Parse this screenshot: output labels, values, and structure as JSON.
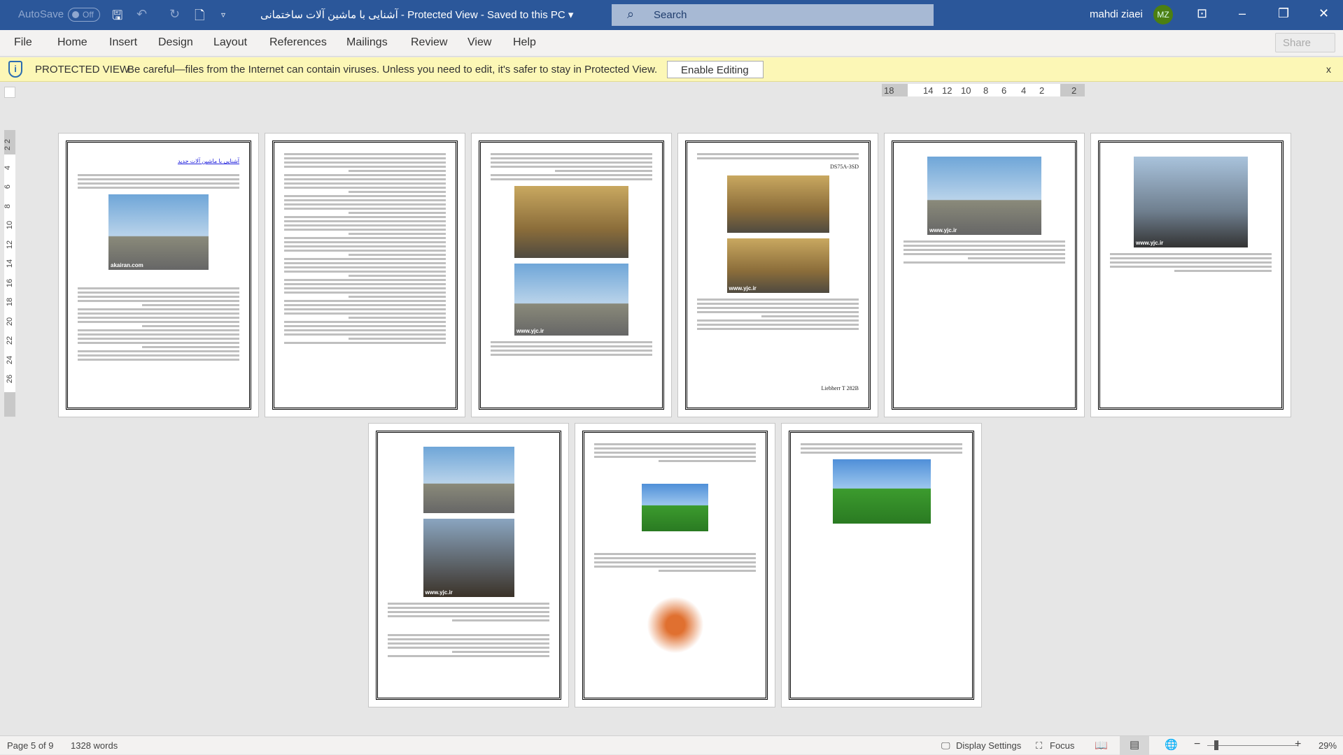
{
  "titlebar": {
    "autosave": "AutoSave",
    "autosave_state": "Off",
    "title": "آشنایی با ماشین آلات ساختمانی  -  Protected View  -  Saved to this PC  ▾",
    "search_placeholder": "Search",
    "user": "mahdi ziaei",
    "initials": "MZ",
    "avatar_color": "#4c7f12"
  },
  "menu": [
    "File",
    "Home",
    "Insert",
    "Design",
    "Layout",
    "References",
    "Mailings",
    "Review",
    "View",
    "Help"
  ],
  "share": "Share",
  "protected": {
    "label": "PROTECTED VIEW",
    "message": "Be careful—files from the Internet can contain viruses. Unless you need to edit, it's safer to stay in Protected View.",
    "enable": "Enable Editing",
    "close": "x"
  },
  "ruler": {
    "h": [
      "18",
      "14",
      "12",
      "10",
      "8",
      "6",
      "4",
      "2",
      "2"
    ],
    "v": [
      "2",
      "2",
      "4",
      "6",
      "8",
      "10",
      "12",
      "14",
      "16",
      "18",
      "20",
      "22",
      "24",
      "26"
    ]
  },
  "doc": {
    "heading": "آشنایی با ماشین آلات جدید",
    "wm_akairan": "akairan.com",
    "wm_yjc": "www.yjc.ir",
    "cap_ds": "DS75A-3SD",
    "cap_liebherr": "Liebherr T 282B"
  },
  "status": {
    "page": "Page 5 of 9",
    "words": "1328 words",
    "display": "Display Settings",
    "focus": "Focus",
    "zoom": "29%"
  }
}
